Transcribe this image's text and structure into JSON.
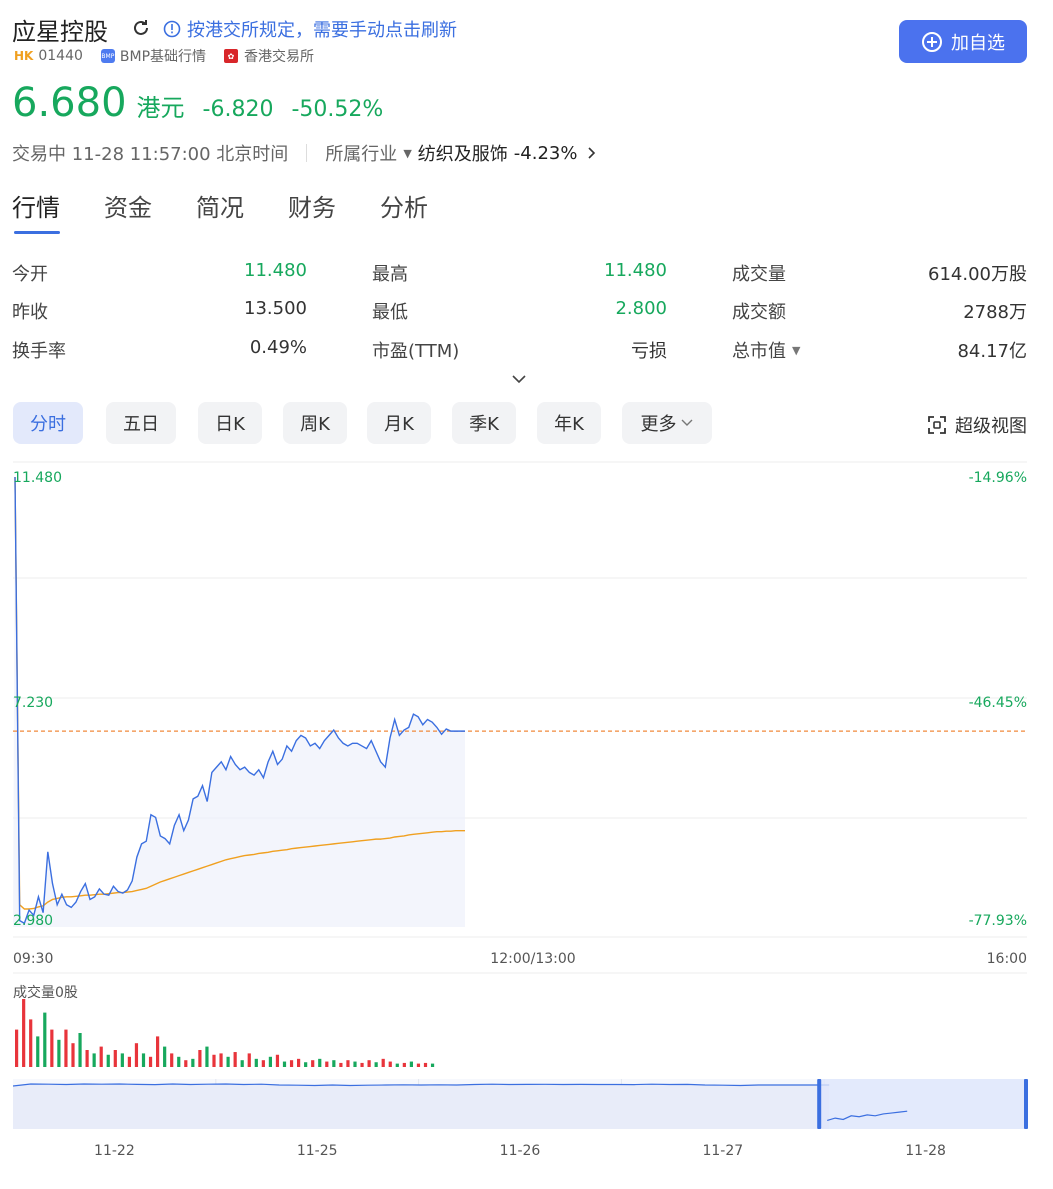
{
  "header": {
    "name": "应星控股",
    "notice": "按港交所规定，需要手动点击刷新",
    "add_watchlist": "加自选",
    "market_badge": "HK",
    "code": "01440",
    "bmp_badge": "BMP",
    "quote_source": "BMP基础行情",
    "exchange": "香港交易所"
  },
  "quote": {
    "price": "6.680",
    "currency": "港元",
    "change": "-6.820",
    "change_pct": "-50.52%",
    "status": "交易中 11-28 11:57:00 北京时间",
    "industry_label": "所属行业",
    "industry_name": "纺织及服饰",
    "industry_change": "-4.23%"
  },
  "tabs": [
    "行情",
    "资金",
    "简况",
    "财务",
    "分析"
  ],
  "stats": [
    [
      {
        "label": "今开",
        "value": "11.480"
      },
      {
        "label": "最高",
        "value": "11.480"
      },
      {
        "label": "成交量",
        "value": "614.00万股"
      }
    ],
    [
      {
        "label": "昨收",
        "value": "13.500"
      },
      {
        "label": "最低",
        "value": "2.800"
      },
      {
        "label": "成交额",
        "value": "2788万"
      }
    ],
    [
      {
        "label": "换手率",
        "value": "0.49%"
      },
      {
        "label": "市盈(TTM)",
        "value": "亏损"
      },
      {
        "label": "总市值",
        "value": "84.17亿"
      }
    ]
  ],
  "period_buttons": [
    "分时",
    "五日",
    "日K",
    "周K",
    "月K",
    "季K",
    "年K",
    "更多"
  ],
  "super_view": "超级视图",
  "colors": {
    "price_line": "#3b6fe0",
    "avg_line": "#f0a020",
    "up": "#e8343b",
    "down": "#17a85d",
    "ref_line": "#f08a3c",
    "accent": "#4b72ee"
  },
  "chart_data": {
    "type": "line",
    "y_left_ticks": [
      "11.480",
      "7.230",
      "2.980"
    ],
    "y_right_ticks": [
      "-14.96%",
      "-46.45%",
      "-77.93%"
    ],
    "x_ticks": [
      "09:30",
      "12:00/13:00",
      "16:00"
    ],
    "ylim": [
      2.98,
      11.48
    ],
    "last_price": 6.68,
    "volume_label": "成交量0股",
    "nav_dates": [
      "11-22",
      "11-25",
      "11-26",
      "11-27",
      "11-28"
    ],
    "price": [
      11.48,
      3.1,
      3.05,
      3.3,
      3.2,
      3.55,
      3.25,
      4.4,
      3.8,
      3.4,
      3.6,
      3.4,
      3.35,
      3.45,
      3.65,
      3.8,
      3.5,
      3.55,
      3.7,
      3.6,
      3.58,
      3.75,
      3.65,
      3.62,
      3.68,
      3.85,
      4.3,
      4.55,
      4.6,
      5.1,
      5.05,
      4.7,
      4.65,
      4.55,
      4.9,
      5.1,
      4.8,
      5.0,
      5.4,
      5.45,
      5.65,
      5.35,
      5.9,
      6.0,
      6.1,
      5.95,
      6.2,
      6.05,
      5.95,
      6.0,
      5.9,
      5.85,
      5.95,
      5.8,
      6.1,
      6.3,
      6.05,
      6.15,
      6.4,
      6.3,
      6.5,
      6.6,
      6.55,
      6.4,
      6.45,
      6.35,
      6.5,
      6.6,
      6.7,
      6.55,
      6.45,
      6.4,
      6.45,
      6.45,
      6.4,
      6.35,
      6.5,
      6.3,
      6.1,
      6.0,
      6.55,
      6.9,
      6.6,
      6.7,
      6.75,
      7.0,
      6.95,
      6.8,
      6.9,
      6.85,
      6.75,
      6.62,
      6.72,
      6.68,
      6.68,
      6.68,
      6.68
    ],
    "avg": [
      11.48,
      3.4,
      3.32,
      3.32,
      3.33,
      3.36,
      3.38,
      3.45,
      3.5,
      3.52,
      3.54,
      3.55,
      3.55,
      3.56,
      3.57,
      3.58,
      3.58,
      3.59,
      3.6,
      3.6,
      3.61,
      3.62,
      3.63,
      3.63,
      3.64,
      3.65,
      3.67,
      3.69,
      3.71,
      3.75,
      3.79,
      3.83,
      3.86,
      3.89,
      3.92,
      3.95,
      3.98,
      4.01,
      4.04,
      4.07,
      4.1,
      4.13,
      4.16,
      4.19,
      4.22,
      4.25,
      4.27,
      4.29,
      4.31,
      4.33,
      4.34,
      4.35,
      4.37,
      4.38,
      4.39,
      4.41,
      4.42,
      4.43,
      4.44,
      4.46,
      4.47,
      4.48,
      4.49,
      4.5,
      4.51,
      4.52,
      4.53,
      4.54,
      4.55,
      4.56,
      4.57,
      4.58,
      4.59,
      4.6,
      4.61,
      4.62,
      4.63,
      4.64,
      4.64,
      4.65,
      4.66,
      4.68,
      4.69,
      4.7,
      4.72,
      4.73,
      4.74,
      4.75,
      4.76,
      4.77,
      4.78,
      4.78,
      4.79,
      4.79,
      4.8,
      4.8,
      4.8
    ],
    "volume": [
      {
        "v": 0.55,
        "d": "up"
      },
      {
        "v": 1.0,
        "d": "up"
      },
      {
        "v": 0.7,
        "d": "up"
      },
      {
        "v": 0.45,
        "d": "down"
      },
      {
        "v": 0.8,
        "d": "down"
      },
      {
        "v": 0.55,
        "d": "up"
      },
      {
        "v": 0.4,
        "d": "down"
      },
      {
        "v": 0.55,
        "d": "up"
      },
      {
        "v": 0.35,
        "d": "up"
      },
      {
        "v": 0.5,
        "d": "down"
      },
      {
        "v": 0.25,
        "d": "up"
      },
      {
        "v": 0.2,
        "d": "down"
      },
      {
        "v": 0.3,
        "d": "up"
      },
      {
        "v": 0.18,
        "d": "down"
      },
      {
        "v": 0.25,
        "d": "up"
      },
      {
        "v": 0.2,
        "d": "down"
      },
      {
        "v": 0.15,
        "d": "up"
      },
      {
        "v": 0.35,
        "d": "up"
      },
      {
        "v": 0.2,
        "d": "down"
      },
      {
        "v": 0.15,
        "d": "up"
      },
      {
        "v": 0.45,
        "d": "up"
      },
      {
        "v": 0.3,
        "d": "down"
      },
      {
        "v": 0.2,
        "d": "up"
      },
      {
        "v": 0.15,
        "d": "down"
      },
      {
        "v": 0.1,
        "d": "up"
      },
      {
        "v": 0.12,
        "d": "down"
      },
      {
        "v": 0.25,
        "d": "up"
      },
      {
        "v": 0.3,
        "d": "down"
      },
      {
        "v": 0.18,
        "d": "up"
      },
      {
        "v": 0.2,
        "d": "up"
      },
      {
        "v": 0.15,
        "d": "down"
      },
      {
        "v": 0.22,
        "d": "up"
      },
      {
        "v": 0.1,
        "d": "down"
      },
      {
        "v": 0.2,
        "d": "up"
      },
      {
        "v": 0.12,
        "d": "down"
      },
      {
        "v": 0.1,
        "d": "up"
      },
      {
        "v": 0.15,
        "d": "down"
      },
      {
        "v": 0.18,
        "d": "up"
      },
      {
        "v": 0.08,
        "d": "down"
      },
      {
        "v": 0.1,
        "d": "up"
      },
      {
        "v": 0.12,
        "d": "up"
      },
      {
        "v": 0.07,
        "d": "down"
      },
      {
        "v": 0.1,
        "d": "up"
      },
      {
        "v": 0.12,
        "d": "down"
      },
      {
        "v": 0.08,
        "d": "up"
      },
      {
        "v": 0.1,
        "d": "down"
      },
      {
        "v": 0.06,
        "d": "up"
      },
      {
        "v": 0.1,
        "d": "up"
      },
      {
        "v": 0.08,
        "d": "down"
      },
      {
        "v": 0.06,
        "d": "up"
      },
      {
        "v": 0.1,
        "d": "up"
      },
      {
        "v": 0.07,
        "d": "down"
      },
      {
        "v": 0.12,
        "d": "up"
      },
      {
        "v": 0.08,
        "d": "up"
      },
      {
        "v": 0.05,
        "d": "down"
      },
      {
        "v": 0.06,
        "d": "up"
      },
      {
        "v": 0.08,
        "d": "down"
      },
      {
        "v": 0.05,
        "d": "up"
      },
      {
        "v": 0.06,
        "d": "up"
      },
      {
        "v": 0.05,
        "d": "down"
      }
    ],
    "nav_trail": [
      0.3,
      0.1,
      0.12,
      0.15,
      0.1,
      0.12,
      0.1,
      0.14,
      0.16,
      0.1,
      0.15,
      0.12,
      0.1,
      0.15,
      0.12,
      0.2,
      0.22,
      0.25,
      0.2,
      0.25,
      0.22,
      0.2,
      0.18,
      0.2,
      0.18,
      0.2,
      0.15,
      0.12,
      0.15,
      0.14,
      0.13,
      0.15,
      0.14,
      0.15,
      0.15,
      0.16,
      0.12,
      0.15,
      0.14,
      0.2,
      0.22,
      0.25,
      0.2,
      0.2,
      0.2,
      0.2,
      0.2
    ],
    "nav_current": [
      0.9,
      0.85,
      0.88,
      0.8,
      0.82,
      0.78,
      0.8,
      0.76,
      0.74,
      0.72,
      0.7
    ]
  }
}
